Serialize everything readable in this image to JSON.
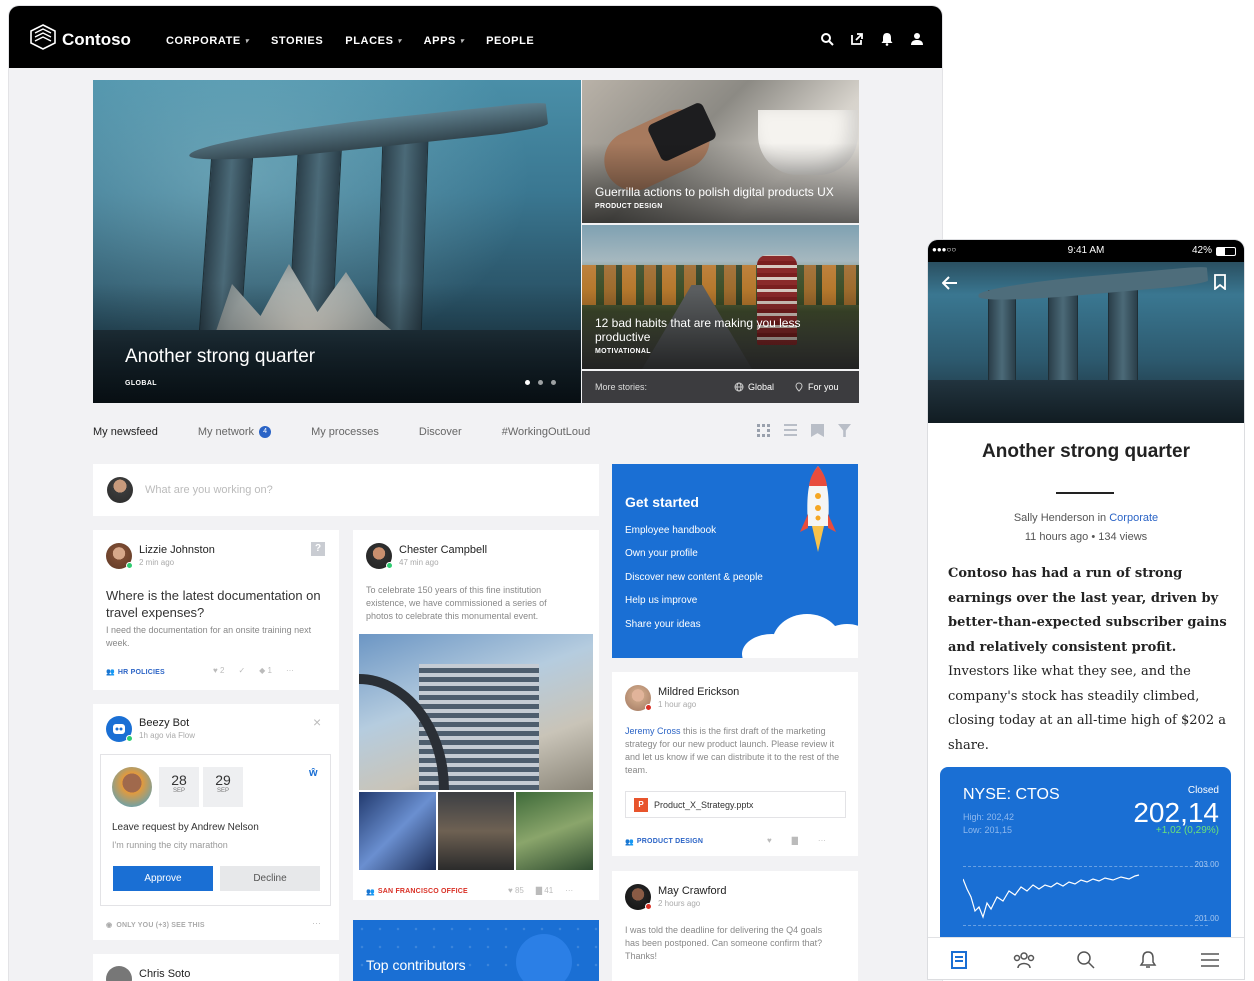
{
  "brand": {
    "name": "Contoso"
  },
  "nav": [
    {
      "label": "CORPORATE",
      "dropdown": true
    },
    {
      "label": "STORIES",
      "dropdown": false
    },
    {
      "label": "PLACES",
      "dropdown": true
    },
    {
      "label": "APPS",
      "dropdown": true
    },
    {
      "label": "PEOPLE",
      "dropdown": false
    }
  ],
  "top_icons": [
    "search-icon",
    "share-icon",
    "bell-icon",
    "user-icon"
  ],
  "hero": {
    "title": "Another strong quarter",
    "tag": "GLOBAL",
    "slides": 3,
    "active_slide": 1
  },
  "cards": [
    {
      "title": "Guerrilla actions to polish digital products UX",
      "tag": "PRODUCT DESIGN"
    },
    {
      "title": "12 bad habits that are making you less productive",
      "tag": "MOTIVATIONAL"
    }
  ],
  "more_stories": {
    "label": "More stories:",
    "global": "Global",
    "for_you": "For you"
  },
  "tabs": [
    {
      "label": "My newsfeed",
      "active": true
    },
    {
      "label": "My network",
      "badge": "4"
    },
    {
      "label": "My processes"
    },
    {
      "label": "Discover"
    },
    {
      "label": "#WorkingOutLoud"
    }
  ],
  "composer": {
    "placeholder": "What are you working on?"
  },
  "post_lizzie": {
    "name": "Lizzie Johnston",
    "time": "2 min ago",
    "question": "Where is the latest documentation on travel expenses?",
    "body": "I need the documentation for an onsite training next week.",
    "footer": "HR POLICIES",
    "likes": "2",
    "tags": "1"
  },
  "post_chester": {
    "name": "Chester Campbell",
    "time": "47 min ago",
    "body": "To celebrate 150 years of this fine institution existence, we have commissioned a series of photos to celebrate this monumental event.",
    "footer": "SAN FRANCISCO OFFICE",
    "likes": "85",
    "comments": "41"
  },
  "bot": {
    "name": "Beezy Bot",
    "time": "1h ago via Flow",
    "date_from": {
      "day": "28",
      "month": "SEP"
    },
    "date_to": {
      "day": "29",
      "month": "SEP"
    },
    "title": "Leave request by Andrew Nelson",
    "note": "I'm running the city marathon",
    "approve": "Approve",
    "decline": "Decline",
    "visibility": "ONLY YOU (+3) SEE THIS"
  },
  "get_started": {
    "title": "Get started",
    "items": [
      "Employee handbook",
      "Own your profile",
      "Discover new content & people",
      "Help us improve",
      "Share your ideas"
    ]
  },
  "post_mildred": {
    "name": "Mildred Erickson",
    "time": "1 hour ago",
    "mention": "Jeremy Cross",
    "body": " this is the first draft of the marketing strategy for our new product launch. Please review it and let us know if we can distribute it to the rest of the team.",
    "file": "Product_X_Strategy.pptx",
    "footer": "PRODUCT DESIGN"
  },
  "post_may": {
    "name": "May Crawford",
    "time": "2 hours ago",
    "body": "I was told the deadline for delivering the Q4 goals has been postponed. Can someone confirm that? Thanks!"
  },
  "chris": {
    "name": "Chris Soto"
  },
  "top_contributors": {
    "title": "Top contributors"
  },
  "mobile": {
    "status": {
      "signal": "●●●○○",
      "time": "9:41 AM",
      "battery": "42%"
    },
    "title": "Another strong quarter",
    "author": "Sally Henderson",
    "author_in": " in ",
    "category": "Corporate",
    "meta": "11 hours ago • 134 views",
    "lead": "Contoso has had a run of strong earnings over the last year, driven by better-than-expected subscriber gains and relatively consistent profit.",
    "text": " Investors like what they see, and the company's stock has steadily climbed, closing today at an all-time high of $202 a share.",
    "stock": {
      "ticker": "NYSE: CTOS",
      "status": "Closed",
      "price": "202,14",
      "change": "+1,02 (0,29%)",
      "high": "High: 202,42",
      "low": "Low: 201,15",
      "axis_top": "203.00",
      "axis_bottom": "201.00"
    },
    "tab_icons": [
      "news-icon",
      "people-icon",
      "search-icon",
      "bell-icon",
      "menu-icon"
    ]
  },
  "colors": {
    "accent": "#1a6fd4",
    "topbar": "#000000",
    "background": "#f2f2f4",
    "alert": "#d93025"
  }
}
